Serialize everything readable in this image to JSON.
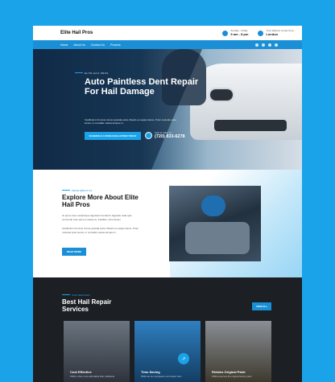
{
  "header": {
    "logo": "Elite Hail Pros",
    "hours_label": "Sunday - Friday",
    "hours_value": "9 am - 8 pm",
    "address_label": "Your address comes here...",
    "address_value": "London"
  },
  "nav": {
    "items": [
      "Home",
      "About Us",
      "Contact Us",
      "Process"
    ]
  },
  "hero": {
    "kicker": "ELITE HAIL PROS",
    "title": "Auto Paintless Dent Repair For Hail Damage",
    "description": "Vestibulum rhoncus nisl ac gravida porta. Mauris eu sapien lacus. Proin molestie justo lectus, in convallis massa tempus in.",
    "cta": "SCHEDULE A FREE EVALUATION TODAY",
    "phone_label": "Call us today at",
    "phone": "(720) 833-6278"
  },
  "about": {
    "kicker": "KNOW ABOUT US",
    "title": "Explore More About Elite Hail Pros",
    "p1": "Ut purus risus scelerisque dignissim hendrerit. Egestas nulla quis commodo cras sed eu massa eu. Facilisis, Urna fusce!",
    "p2": "Vestibulum rhoncus nisl ac gravida porta. Mauris eu sapien lacus. Proin molestie justo lectus, in convallis massa tempus in.",
    "cta": "READ MORE"
  },
  "services": {
    "kicker": "OUR SERVICES",
    "title": "Best Hail Repair Services",
    "cta": "VIEW ALL",
    "cards": [
      {
        "title": "Cost Effective",
        "desc": "PDR is often more affordable than traditional",
        "color": "#5a6470"
      },
      {
        "title": "Time-Saving",
        "desc": "PDR can be completed much faster than",
        "color": "#2b6da3"
      },
      {
        "title": "Retains Original Paint",
        "desc": "PDR preserves the original factory paint",
        "color": "#7a6a4a"
      }
    ]
  },
  "colors": {
    "accent": "#1aa3e8",
    "nav": "#1a8fd6",
    "dark": "#1c1f24"
  }
}
